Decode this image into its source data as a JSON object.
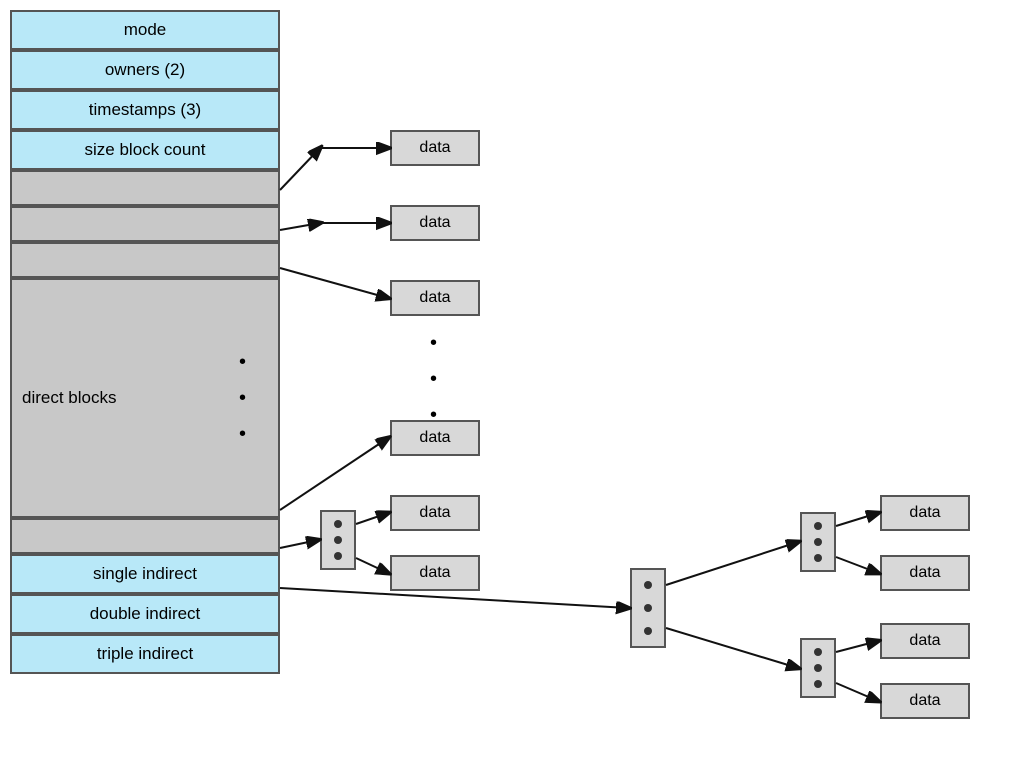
{
  "inode": {
    "cells_blue": [
      "mode",
      "owners (2)",
      "timestamps (3)",
      "size block count"
    ],
    "direct_blocks_label": "direct blocks",
    "single_indirect_label": "single indirect",
    "double_indirect_label": "double indirect",
    "triple_indirect_label": "triple indirect"
  },
  "data_label": "data",
  "dots": "•\n•\n•"
}
